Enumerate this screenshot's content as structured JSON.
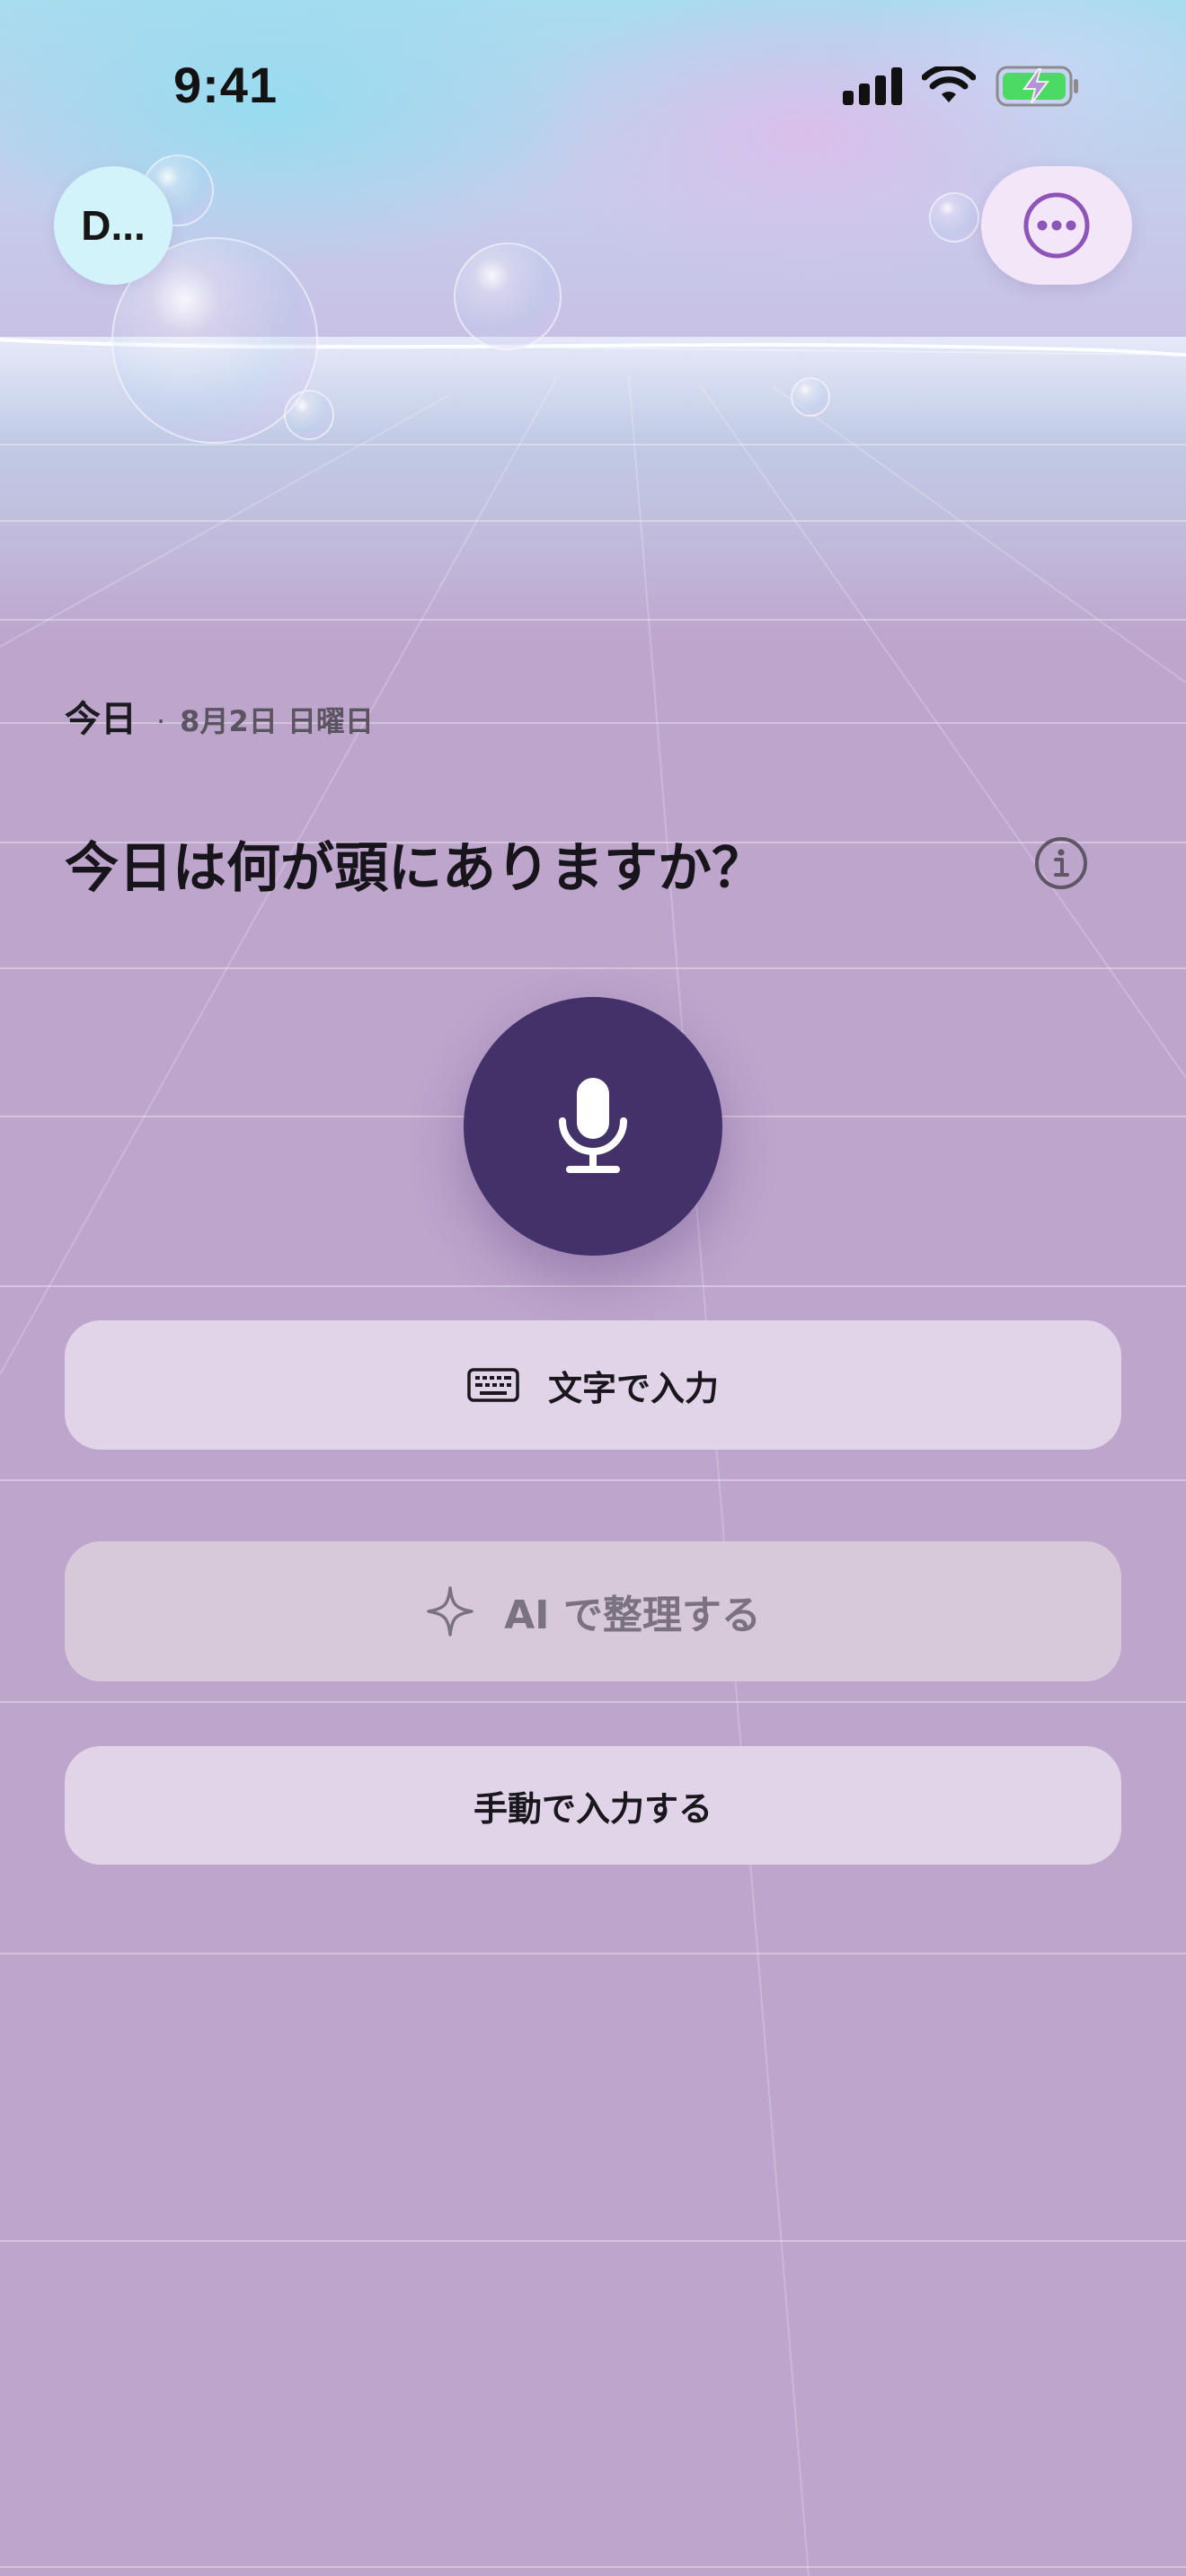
{
  "status_bar": {
    "time": "9:41"
  },
  "header": {
    "avatar_label": "D...",
    "more_icon": "ellipsis-circle-icon"
  },
  "date": {
    "today_label": "今日",
    "separator": "·",
    "full_date": "8月2日 日曜日"
  },
  "prompt": {
    "title": "今日は何が頭にありますか？",
    "info_icon": "info-circle-icon"
  },
  "actions": {
    "mic_icon": "microphone-icon",
    "text_input_label": "文字で入力",
    "text_input_icon": "keyboard-icon",
    "ai_organize_label": "AI で整理する",
    "ai_organize_icon": "sparkle-icon",
    "manual_input_label": "手動で入力する"
  },
  "colors": {
    "accent": "#43316A",
    "background": "#BDA5CC",
    "more_icon": "#8E55B8",
    "battery": "#4CD964"
  }
}
